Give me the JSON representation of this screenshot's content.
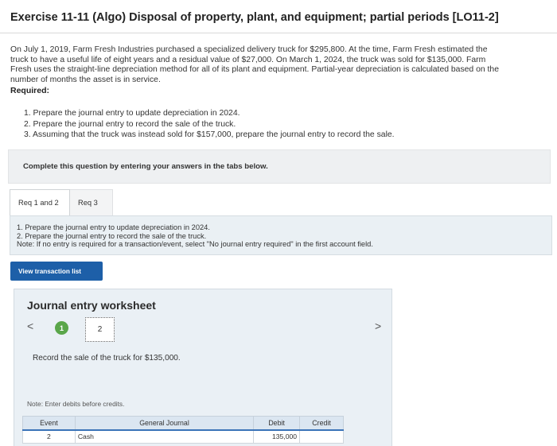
{
  "header": {
    "title": "Exercise 11-11 (Algo) Disposal of property, plant, and equipment; partial periods [LO11-2]"
  },
  "problem": {
    "intro_lines": [
      "On July 1, 2019, Farm Fresh Industries purchased a specialized delivery truck for $295,800. At the time, Farm Fresh estimated the",
      "truck to have a useful life of eight years and a residual value of $27,000. On March 1, 2024, the truck was sold for $135,000. Farm",
      "Fresh uses the straight-line depreciation method for all of its plant and equipment. Partial-year depreciation is calculated based on the",
      "number of months the asset is in service."
    ],
    "required_label": "Required:",
    "requirements": [
      "1. Prepare the journal entry to update depreciation in 2024.",
      "2. Prepare the journal entry to record the sale of the truck.",
      "3. Assuming that the truck was instead sold for $157,000, prepare the journal entry to record the sale."
    ]
  },
  "instructions": {
    "text": "Complete this question by entering your answers in the tabs below."
  },
  "tabs": [
    {
      "label": "Req 1 and 2",
      "active": true
    },
    {
      "label": "Req 3",
      "active": false
    }
  ],
  "req_panel": {
    "lines": [
      "1. Prepare the journal entry to update depreciation in 2024.",
      "2. Prepare the journal entry to record the sale of the truck.",
      "Note: If no entry is required for a transaction/event, select \"No journal entry required\" in the first account field."
    ]
  },
  "buttons": {
    "view_transaction_list": "View transaction list"
  },
  "worksheet": {
    "title": "Journal entry worksheet",
    "prev_glyph": "<",
    "next_glyph": ">",
    "steps": [
      {
        "label": "1",
        "completed": true
      },
      {
        "label": "2",
        "current": true
      }
    ],
    "record_text": "Record the sale of the truck for $135,000.",
    "note": "Note: Enter debits before credits."
  },
  "journal_table": {
    "headers": {
      "event": "Event",
      "account": "General Journal",
      "debit": "Debit",
      "credit": "Credit"
    },
    "rows": [
      {
        "event": "2",
        "account": "Cash",
        "debit": "135,000",
        "credit": ""
      }
    ]
  },
  "colors": {
    "accent_blue": "#1d5fa8",
    "step_green": "#5aa64a",
    "panel_bg": "#eaf0f4"
  }
}
